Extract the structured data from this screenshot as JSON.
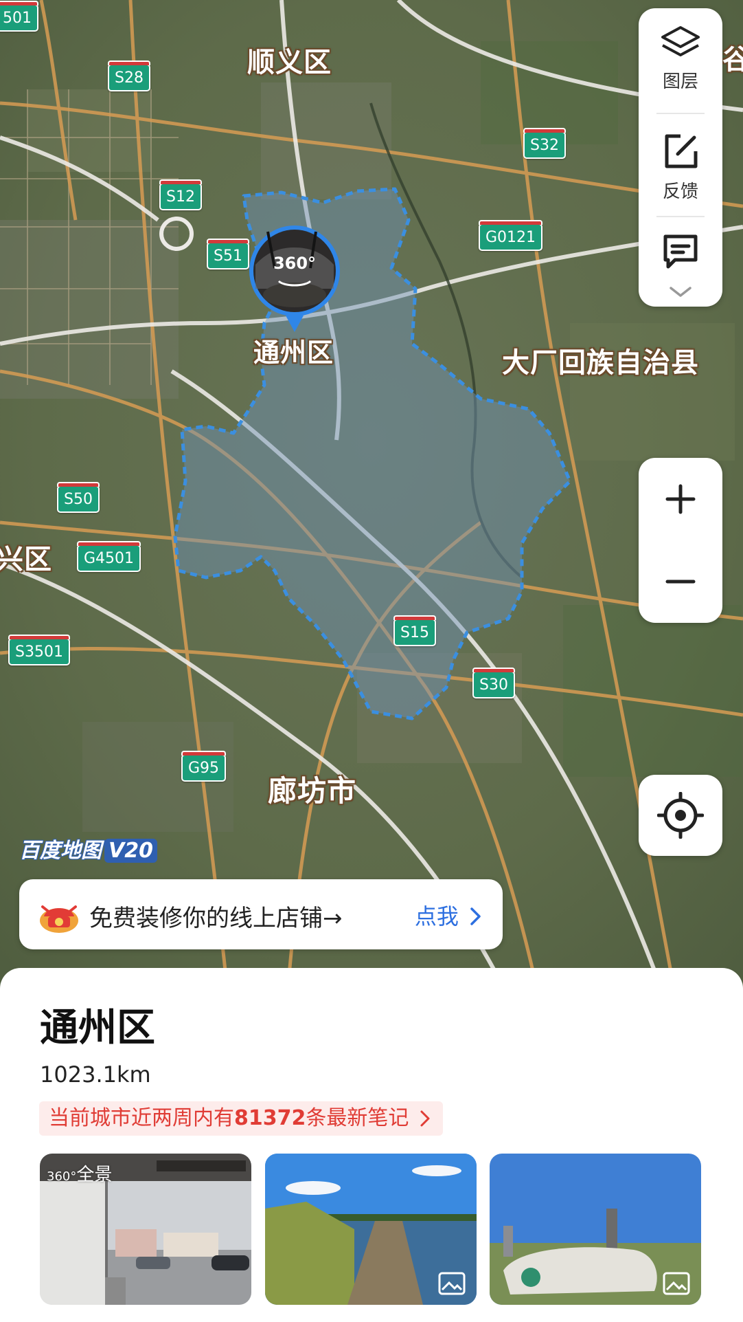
{
  "map": {
    "place_labels": [
      {
        "id": "shunyi",
        "text": "顺义区"
      },
      {
        "id": "tongzhou",
        "text": "通州区"
      },
      {
        "id": "dachang",
        "text": "大厂回族自治县"
      },
      {
        "id": "langfang",
        "text": "廊坊市"
      },
      {
        "id": "xing_partial",
        "text": "兴区"
      },
      {
        "id": "gu_partial",
        "text": "谷"
      }
    ],
    "road_shields": [
      "501",
      "S28",
      "S32",
      "S12",
      "G0121",
      "S51",
      "S50",
      "G4501",
      "S15",
      "S3501",
      "S30",
      "G95"
    ],
    "pano_marker_text": "360°",
    "watermark": {
      "brand": "百度地图",
      "version": "V20"
    },
    "highlight_color": "#3b8fe0"
  },
  "controls": {
    "layers_label": "图层",
    "feedback_label": "反馈",
    "zoom_in": "+",
    "zoom_out": "−"
  },
  "promo": {
    "text": "免费装修你的线上店铺→",
    "link": "点我"
  },
  "sheet": {
    "title": "通州区",
    "area": "1023.1km",
    "notes_prefix": "当前城市近两周内有",
    "notes_count": "81372",
    "notes_suffix": "条最新笔记",
    "pano_tag": "全景",
    "pano_prefix": "360°"
  }
}
